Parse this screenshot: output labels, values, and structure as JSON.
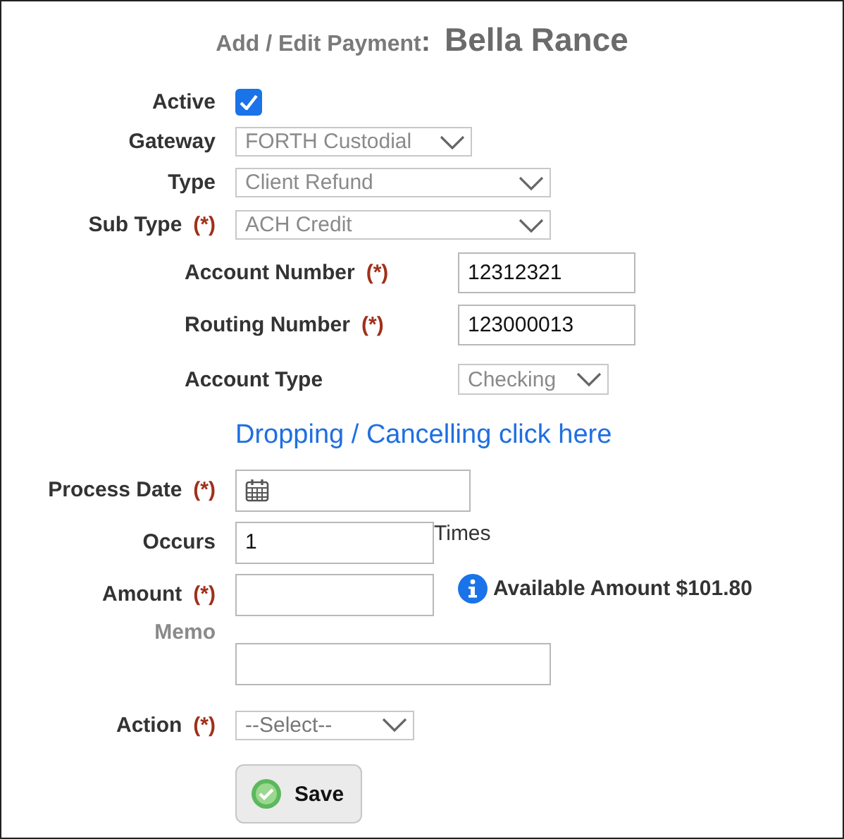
{
  "title": {
    "prefix": "Add / Edit Payment",
    "separator": ":",
    "name": "Bella Rance"
  },
  "top_fields": [
    {
      "kind": "checkbox",
      "label": "Active",
      "checked": true
    },
    {
      "kind": "select",
      "label": "Gateway",
      "value": "FORTH Custodial",
      "disabled": true
    },
    {
      "kind": "select",
      "label": "Type",
      "value": "Client Refund",
      "disabled": true
    },
    {
      "kind": "select",
      "label": "Sub Type",
      "required": "(*)",
      "value": "ACH Credit",
      "disabled": true
    }
  ],
  "account_fields": [
    {
      "kind": "text",
      "label": "Account Number",
      "required": "(*)",
      "value": "12312321"
    },
    {
      "kind": "text",
      "label": "Routing Number",
      "required": "(*)",
      "value": "123000013"
    },
    {
      "kind": "select",
      "label": "Account Type",
      "value": "Checking",
      "disabled": true
    }
  ],
  "link": "Dropping / Cancelling click here",
  "bottom_fields": [
    {
      "kind": "date",
      "label": "Process Date",
      "required": "(*)"
    },
    {
      "kind": "text",
      "label": "Occurs",
      "value": "1",
      "suffix": "Times"
    },
    {
      "kind": "text",
      "label": "Amount",
      "required": "(*)",
      "note": "Available Amount $101.80"
    },
    {
      "kind": "text",
      "label": "Memo",
      "muted": true
    },
    {
      "kind": "select",
      "label": "Action",
      "required": "(*)",
      "placeholder": "--Select--",
      "disabled": false
    }
  ],
  "save_button": "Save"
}
